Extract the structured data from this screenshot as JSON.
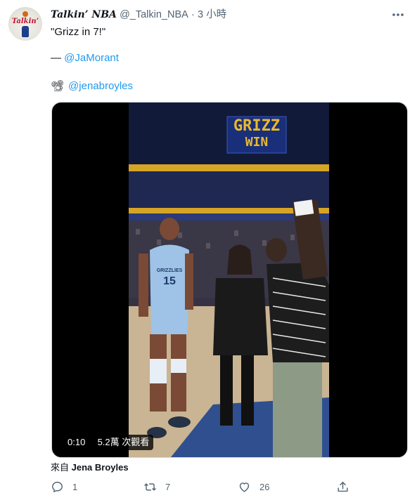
{
  "header": {
    "display_name": "Talkin’ NBA",
    "handle": "@_Talkin_NBA",
    "separator": "·",
    "timestamp": "3 小時"
  },
  "avatar": {
    "text": "Talkin’"
  },
  "tweet": {
    "line1": "\"Grizz in 7!\"",
    "line2_prefix": "— ",
    "line2_mention": "@JaMorant",
    "line3_emoji": "📽",
    "line3_mention": "@jenabroyles"
  },
  "video": {
    "duration": "0:10",
    "views": "5.2萬 次觀看",
    "scoreboard_line1": "GRIZZ",
    "scoreboard_line2": "WIN",
    "jersey_number": "15",
    "jersey_name": "GRIZZLIES"
  },
  "source": {
    "prefix": "來自",
    "name": "Jena Broyles"
  },
  "actions": {
    "reply_count": "1",
    "retweet_count": "7",
    "like_count": "26"
  },
  "colors": {
    "link": "#1d9bf0",
    "secondary_text": "#536471",
    "scoreboard_text": "#e8b92e"
  }
}
